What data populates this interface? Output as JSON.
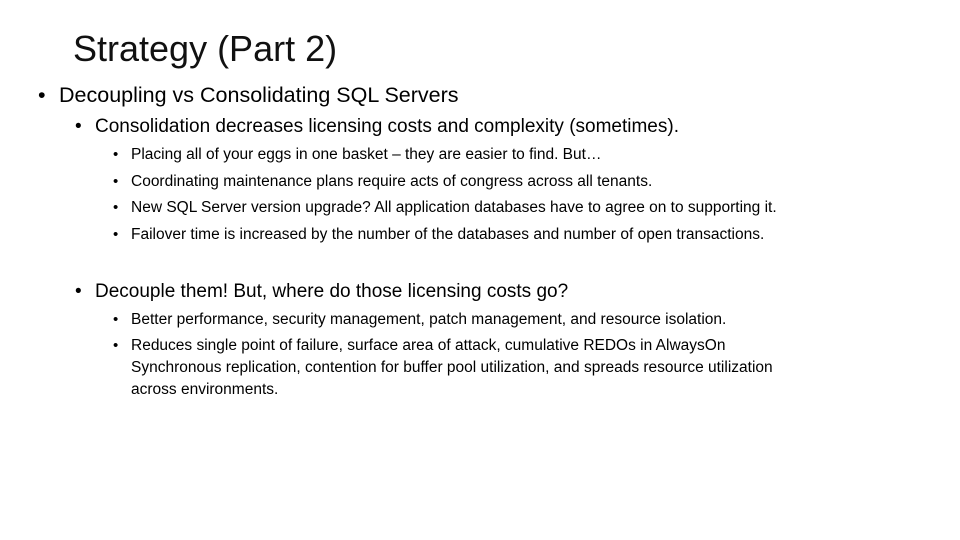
{
  "slide": {
    "title": "Strategy (Part 2)",
    "bullet_char": "•",
    "level1": {
      "text": "Decoupling vs Consolidating SQL Servers"
    },
    "section_a": {
      "text": "Consolidation decreases licensing costs and complexity (sometimes).",
      "items": [
        "Placing all of your eggs in one basket – they are easier to find. But…",
        "Coordinating maintenance plans require acts of congress across all tenants.",
        "New SQL Server version upgrade? All application databases have to agree on to supporting it.",
        "Failover time is increased by the number of the databases and number of open transactions."
      ]
    },
    "section_b": {
      "text": "Decouple them! But, where do those licensing costs go?",
      "items": [
        "Better performance, security management, patch management, and resource isolation.",
        "Reduces single point of failure, surface area of attack, cumulative REDOs in AlwaysOn",
        "Synchronous replication, contention for buffer pool utilization, and spreads resource utilization",
        "across environments."
      ]
    }
  }
}
